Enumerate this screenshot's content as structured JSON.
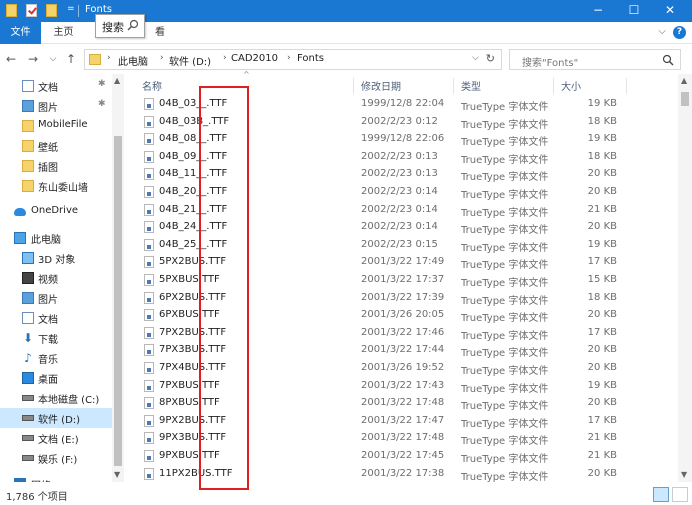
{
  "window": {
    "title": "Fonts"
  },
  "ribbon": {
    "tabs": [
      "文件",
      "主页",
      "查看"
    ],
    "view_tab_visible": "看",
    "tooltip": "搜索"
  },
  "address": {
    "crumbs": [
      "此电脑",
      "软件 (D:)",
      "CAD2010",
      "Fonts"
    ]
  },
  "search": {
    "placeholder": "搜索\"Fonts\""
  },
  "sidebar": {
    "items": [
      {
        "label": "文档",
        "icon": "document-icon",
        "pinned": true
      },
      {
        "label": "图片",
        "icon": "pictures-icon",
        "pinned": true
      },
      {
        "label": "MobileFile",
        "icon": "folder-icon"
      },
      {
        "label": "壁纸",
        "icon": "folder-icon"
      },
      {
        "label": "插图",
        "icon": "folder-icon"
      },
      {
        "label": "东山委山墙",
        "icon": "folder-icon"
      },
      {
        "label": "OneDrive",
        "icon": "cloud-icon"
      },
      {
        "label": "此电脑",
        "icon": "computer-icon"
      },
      {
        "label": "3D 对象",
        "icon": "3d-objects-icon"
      },
      {
        "label": "视频",
        "icon": "video-icon"
      },
      {
        "label": "图片",
        "icon": "pictures-icon"
      },
      {
        "label": "文档",
        "icon": "document-icon"
      },
      {
        "label": "下载",
        "icon": "download-icon"
      },
      {
        "label": "音乐",
        "icon": "music-icon"
      },
      {
        "label": "桌面",
        "icon": "desktop-icon"
      },
      {
        "label": "本地磁盘 (C:)",
        "icon": "drive-icon"
      },
      {
        "label": "软件 (D:)",
        "icon": "drive-icon",
        "selected": true
      },
      {
        "label": "文档 (E:)",
        "icon": "drive-icon"
      },
      {
        "label": "娱乐 (F:)",
        "icon": "drive-icon"
      },
      {
        "label": "网络",
        "icon": "network-icon"
      }
    ]
  },
  "list": {
    "headers": {
      "name": "名称",
      "date": "修改日期",
      "type": "类型",
      "size": "大小"
    },
    "rows": [
      {
        "name": "04B_03__.TTF",
        "date": "1999/12/8 22:04",
        "type": "TrueType 字体文件",
        "size": "19 KB"
      },
      {
        "name": "04B_03B_.TTF",
        "date": "2002/2/23 0:12",
        "type": "TrueType 字体文件",
        "size": "18 KB"
      },
      {
        "name": "04B_08__.TTF",
        "date": "1999/12/8 22:06",
        "type": "TrueType 字体文件",
        "size": "19 KB"
      },
      {
        "name": "04B_09__.TTF",
        "date": "2002/2/23 0:13",
        "type": "TrueType 字体文件",
        "size": "18 KB"
      },
      {
        "name": "04B_11__.TTF",
        "date": "2002/2/23 0:13",
        "type": "TrueType 字体文件",
        "size": "20 KB"
      },
      {
        "name": "04B_20__.TTF",
        "date": "2002/2/23 0:14",
        "type": "TrueType 字体文件",
        "size": "20 KB"
      },
      {
        "name": "04B_21__.TTF",
        "date": "2002/2/23 0:14",
        "type": "TrueType 字体文件",
        "size": "21 KB"
      },
      {
        "name": "04B_24__.TTF",
        "date": "2002/2/23 0:14",
        "type": "TrueType 字体文件",
        "size": "20 KB"
      },
      {
        "name": "04B_25__.TTF",
        "date": "2002/2/23 0:15",
        "type": "TrueType 字体文件",
        "size": "19 KB"
      },
      {
        "name": "5PX2BUS.TTF",
        "date": "2001/3/22 17:49",
        "type": "TrueType 字体文件",
        "size": "17 KB"
      },
      {
        "name": "5PXBUS.TTF",
        "date": "2001/3/22 17:37",
        "type": "TrueType 字体文件",
        "size": "15 KB"
      },
      {
        "name": "6PX2BUS.TTF",
        "date": "2001/3/22 17:39",
        "type": "TrueType 字体文件",
        "size": "18 KB"
      },
      {
        "name": "6PXBUS.TTF",
        "date": "2001/3/26 20:05",
        "type": "TrueType 字体文件",
        "size": "20 KB"
      },
      {
        "name": "7PX2BUS.TTF",
        "date": "2001/3/22 17:46",
        "type": "TrueType 字体文件",
        "size": "17 KB"
      },
      {
        "name": "7PX3BUS.TTF",
        "date": "2001/3/22 17:44",
        "type": "TrueType 字体文件",
        "size": "20 KB"
      },
      {
        "name": "7PX4BUS.TTF",
        "date": "2001/3/26 19:52",
        "type": "TrueType 字体文件",
        "size": "20 KB"
      },
      {
        "name": "7PXBUS.TTF",
        "date": "2001/3/22 17:43",
        "type": "TrueType 字体文件",
        "size": "19 KB"
      },
      {
        "name": "8PXBUS.TTF",
        "date": "2001/3/22 17:48",
        "type": "TrueType 字体文件",
        "size": "20 KB"
      },
      {
        "name": "9PX2BUS.TTF",
        "date": "2001/3/22 17:47",
        "type": "TrueType 字体文件",
        "size": "17 KB"
      },
      {
        "name": "9PX3BUS.TTF",
        "date": "2001/3/22 17:48",
        "type": "TrueType 字体文件",
        "size": "21 KB"
      },
      {
        "name": "9PXBUS.TTF",
        "date": "2001/3/22 17:45",
        "type": "TrueType 字体文件",
        "size": "21 KB"
      },
      {
        "name": "11PX2BUS.TTF",
        "date": "2001/3/22 17:38",
        "type": "TrueType 字体文件",
        "size": "20 KB"
      }
    ]
  },
  "status": {
    "item_count": "1,786 个项目"
  },
  "colors": {
    "accent": "#1a78d2",
    "selection": "#cce8ff",
    "highlight_box": "#e02020"
  }
}
